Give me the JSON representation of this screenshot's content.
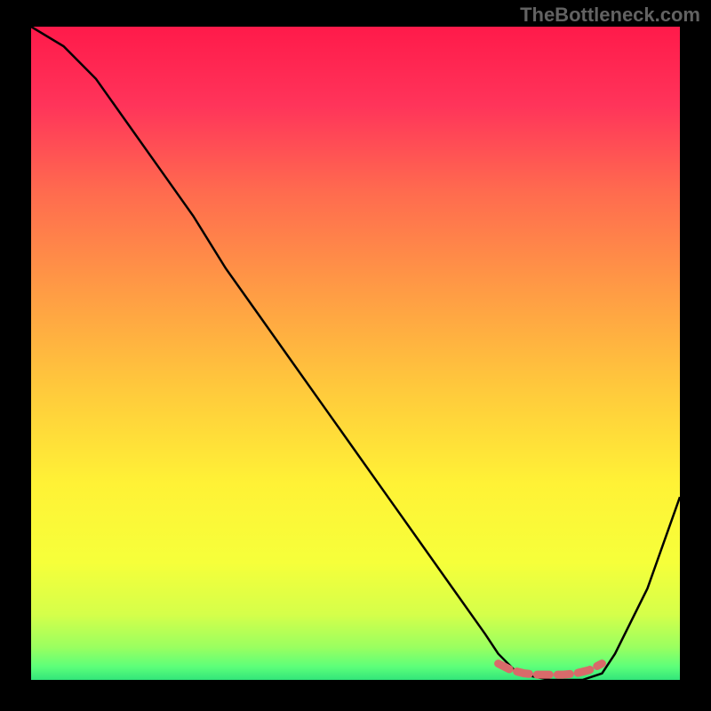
{
  "watermark": "TheBottleneck.com",
  "chart_data": {
    "type": "line",
    "title": "",
    "xlabel": "",
    "ylabel": "",
    "xlim": [
      0,
      100
    ],
    "ylim": [
      0,
      100
    ],
    "series": [
      {
        "name": "bottleneck-curve",
        "x": [
          0,
          5,
          10,
          15,
          20,
          25,
          30,
          35,
          40,
          45,
          50,
          55,
          60,
          65,
          70,
          72,
          75,
          80,
          85,
          88,
          90,
          95,
          100
        ],
        "y": [
          100,
          97,
          92,
          85,
          78,
          71,
          63,
          56,
          49,
          42,
          35,
          28,
          21,
          14,
          7,
          4,
          1,
          0,
          0,
          1,
          4,
          14,
          28
        ],
        "color": "#000000"
      },
      {
        "name": "optimal-zone",
        "x": [
          72,
          74,
          76,
          78,
          80,
          82,
          84,
          86,
          88
        ],
        "y": [
          2.5,
          1.5,
          1,
          0.8,
          0.8,
          0.8,
          1,
          1.5,
          2.5
        ],
        "color": "#d96a6a"
      }
    ],
    "gradient_stops": [
      {
        "pos": 0.0,
        "color": "#ff1a4a"
      },
      {
        "pos": 0.12,
        "color": "#ff345a"
      },
      {
        "pos": 0.25,
        "color": "#ff6a4f"
      },
      {
        "pos": 0.4,
        "color": "#ff9a45"
      },
      {
        "pos": 0.55,
        "color": "#ffc83c"
      },
      {
        "pos": 0.7,
        "color": "#fff236"
      },
      {
        "pos": 0.82,
        "color": "#f6ff3a"
      },
      {
        "pos": 0.9,
        "color": "#d5ff4a"
      },
      {
        "pos": 0.95,
        "color": "#9aff60"
      },
      {
        "pos": 0.98,
        "color": "#5cff7a"
      },
      {
        "pos": 1.0,
        "color": "#32e57a"
      }
    ]
  }
}
